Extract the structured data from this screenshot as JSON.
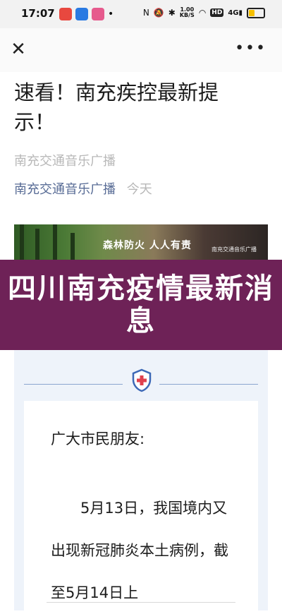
{
  "status_bar": {
    "time": "17:07",
    "net_speed_value": "1.00",
    "net_speed_unit": "KB/S",
    "hd_label": "HD",
    "signal_label": "4G",
    "battery_level_percent": 45,
    "app_icon_colors": [
      "#e8483f",
      "#2a7ae2",
      "#e65a8d"
    ]
  },
  "article": {
    "title": "速看！南充疾控最新提示！",
    "account_name": "南充交通音乐广播",
    "account_link": "南充交通音乐广播",
    "date": "今天"
  },
  "banner": {
    "slogan": "森林防火  人人有责",
    "credit": "南充交通音乐广播"
  },
  "overlay": {
    "headline": "四川南充疫情最新消息",
    "background_color": "#6e2257"
  },
  "notice": {
    "greeting": "广大市民朋友:",
    "body": "5月13日，我国境内又出现新冠肺炎本土病例，截至5月14日上"
  }
}
